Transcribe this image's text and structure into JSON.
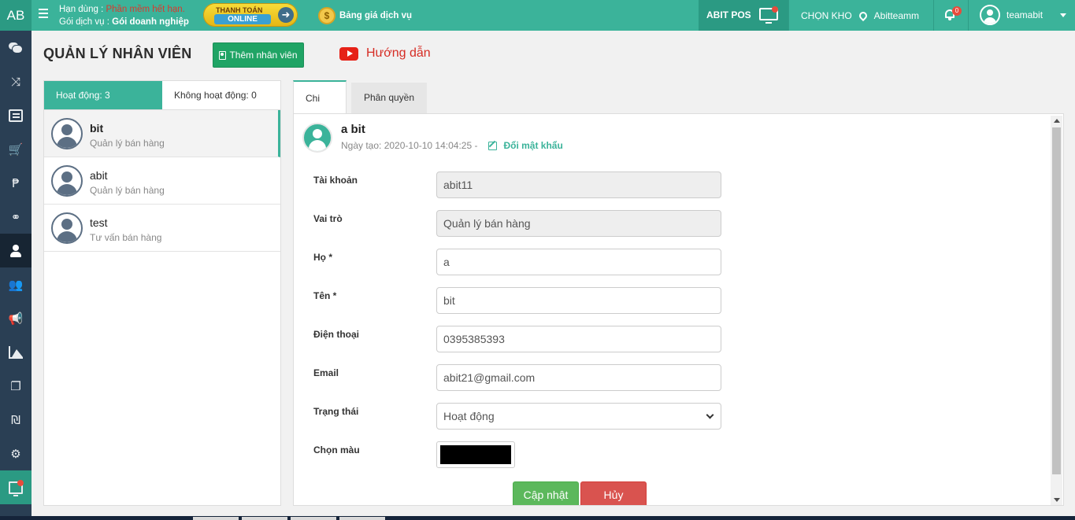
{
  "topbar": {
    "logo": "AB",
    "trial_prefix": "Hạn dùng : ",
    "trial_status": "Phần mềm hết hạn.",
    "plan_prefix": "Gói dịch vụ : ",
    "plan_name": "Gói doanh nghiệp",
    "pay_line1": "THANH TOÁN",
    "pay_line2": "ONLINE",
    "pricing_label": "Bảng giá dịch vụ",
    "pos_label": "ABIT POS",
    "warehouse_label": "CHỌN KHO",
    "warehouse_name": "Abitteamm",
    "notification_count": "0",
    "username": "teamabit"
  },
  "sidebar": {
    "items": [
      {
        "icon": "chat-icon"
      },
      {
        "icon": "shuffle-icon"
      },
      {
        "icon": "newspaper-icon"
      },
      {
        "icon": "cart-icon"
      },
      {
        "icon": "product-icon"
      },
      {
        "icon": "handshake-icon"
      },
      {
        "icon": "user-icon",
        "active": true
      },
      {
        "icon": "users-icon"
      },
      {
        "icon": "megaphone-icon"
      },
      {
        "icon": "area-chart-icon"
      },
      {
        "icon": "copy-icon"
      },
      {
        "icon": "currency-icon"
      },
      {
        "icon": "settings-icon"
      },
      {
        "icon": "monitor-icon"
      }
    ]
  },
  "page": {
    "title": "QUẢN LÝ NHÂN VIÊN",
    "add_button": "Thêm nhân viên",
    "guide_label": "Hướng dẫn"
  },
  "employee_list": {
    "tab_active": "Hoạt động: 3",
    "tab_inactive": "Không hoạt động: 0",
    "employees": [
      {
        "name": "bit",
        "role": "Quản lý bán hàng"
      },
      {
        "name": "abit",
        "role": "Quản lý bán hàng"
      },
      {
        "name": "test",
        "role": "Tư vấn bán hàng"
      }
    ]
  },
  "detail": {
    "tab_detail": "Chi tiết",
    "tab_permission": "Phân quyền",
    "full_name": "a bit",
    "created_label": "Ngày tạo: 2020-10-10 14:04:25 -",
    "change_password": "Đổi mật khẩu",
    "fields": {
      "account_label": "Tài khoản",
      "account_value": "abit11",
      "role_label": "Vai trò",
      "role_value": "Quản lý bán hàng",
      "last_name_label": "Họ *",
      "last_name_value": "a",
      "first_name_label": "Tên *",
      "first_name_value": "bit",
      "phone_label": "Điện thoại",
      "phone_value": "0395385393",
      "email_label": "Email",
      "email_value": "abit21@gmail.com",
      "status_label": "Trạng thái",
      "status_value": "Hoạt động",
      "color_label": "Chọn màu",
      "color_value": "#000000"
    },
    "update_button": "Cập nhật",
    "cancel_button": "Hủy"
  },
  "colors": {
    "accent": "#3bb39a",
    "sidebar": "#2a3f54",
    "add_button": "#20a465",
    "update_button": "#5cb85c",
    "cancel_button": "#d9534f",
    "guide_text": "#d62c24"
  }
}
